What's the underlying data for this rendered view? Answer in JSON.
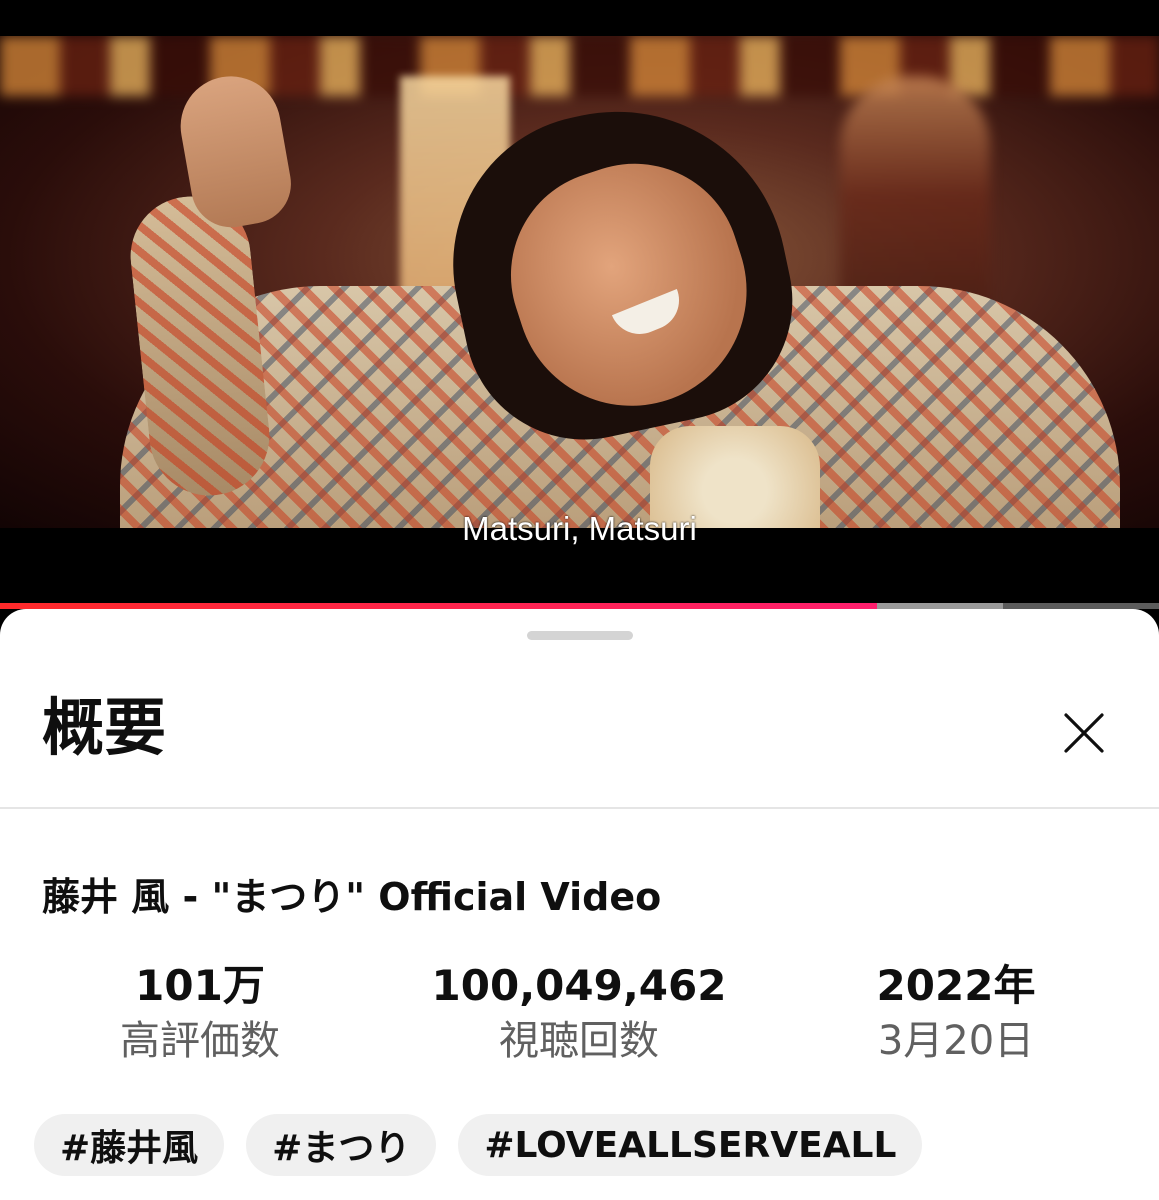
{
  "player": {
    "subtitle": "Matsuri, Matsuri",
    "progress": {
      "played_fraction": 0.757,
      "buffered_fraction": 0.865
    },
    "accent_color": "#ff0033"
  },
  "description_panel": {
    "title": "概要",
    "close_icon": "close-icon",
    "video_title": "藤井 風 - \"まつり\" Official Video",
    "stats": [
      {
        "value": "101万",
        "label": "高評価数"
      },
      {
        "value": "100,049,462",
        "label": "視聴回数"
      },
      {
        "value": "2022年",
        "label": "3月20日"
      }
    ],
    "hashtags": [
      "#藤井風",
      "#まつり",
      "#LOVEALLSERVEALL"
    ]
  }
}
